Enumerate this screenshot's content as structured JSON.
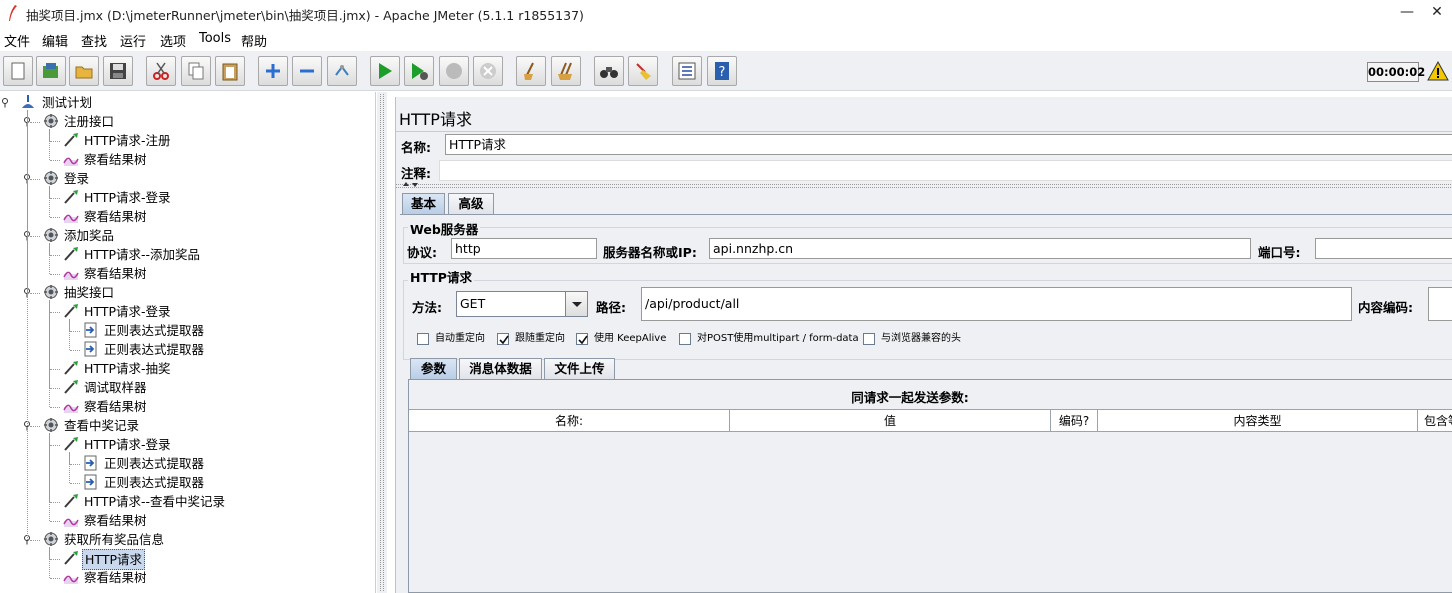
{
  "window": {
    "title": "抽奖项目.jmx (D:\\jmeterRunner\\jmeter\\bin\\抽奖项目.jmx) - Apache JMeter (5.1.1 r1855137)",
    "minimize": "—",
    "close": "✕"
  },
  "menu": [
    "文件",
    "编辑",
    "查找",
    "运行",
    "选项",
    "Tools",
    "帮助"
  ],
  "toolbar": {
    "icons": [
      "new-icon",
      "templates-icon",
      "open-icon",
      "save-icon",
      "cut-icon",
      "copy-icon",
      "paste-icon",
      "expand-icon",
      "collapse-icon",
      "toggle-icon",
      "start-icon",
      "start-no-pause-icon",
      "stop-icon",
      "shutdown-icon",
      "clear-icon",
      "clear-all-icon",
      "search-icon",
      "reset-search-icon",
      "function-helper-icon",
      "help-icon"
    ],
    "timer": "00:00:02",
    "warning_icon": "warning-icon"
  },
  "tree": [
    {
      "label": "测试计划",
      "type": "plan",
      "depth": 0
    },
    {
      "label": "注册接口",
      "type": "thread",
      "depth": 1
    },
    {
      "label": "HTTP请求-注册",
      "type": "sampler",
      "depth": 2
    },
    {
      "label": "察看结果树",
      "type": "listener",
      "depth": 2
    },
    {
      "label": "登录",
      "type": "thread",
      "depth": 1
    },
    {
      "label": "HTTP请求-登录",
      "type": "sampler",
      "depth": 2
    },
    {
      "label": "察看结果树",
      "type": "listener",
      "depth": 2
    },
    {
      "label": "添加奖品",
      "type": "thread",
      "depth": 1
    },
    {
      "label": "HTTP请求--添加奖品",
      "type": "sampler",
      "depth": 2
    },
    {
      "label": "察看结果树",
      "type": "listener",
      "depth": 2
    },
    {
      "label": "抽奖接口",
      "type": "thread",
      "depth": 1
    },
    {
      "label": "HTTP请求-登录",
      "type": "sampler",
      "depth": 2
    },
    {
      "label": "正则表达式提取器",
      "type": "extractor",
      "depth": 3
    },
    {
      "label": "正则表达式提取器",
      "type": "extractor",
      "depth": 3
    },
    {
      "label": "HTTP请求-抽奖",
      "type": "sampler",
      "depth": 2
    },
    {
      "label": "调试取样器",
      "type": "sampler",
      "depth": 2
    },
    {
      "label": "察看结果树",
      "type": "listener",
      "depth": 2
    },
    {
      "label": "查看中奖记录",
      "type": "thread",
      "depth": 1
    },
    {
      "label": "HTTP请求-登录",
      "type": "sampler",
      "depth": 2
    },
    {
      "label": "正则表达式提取器",
      "type": "extractor",
      "depth": 3
    },
    {
      "label": "正则表达式提取器",
      "type": "extractor",
      "depth": 3
    },
    {
      "label": "HTTP请求--查看中奖记录",
      "type": "sampler",
      "depth": 2
    },
    {
      "label": "察看结果树",
      "type": "listener",
      "depth": 2
    },
    {
      "label": "获取所有奖品信息",
      "type": "thread",
      "depth": 1
    },
    {
      "label": "HTTP请求",
      "type": "sampler",
      "depth": 2,
      "selected": true
    },
    {
      "label": "察看结果树",
      "type": "listener",
      "depth": 2
    }
  ],
  "panel": {
    "title": "HTTP请求",
    "name_label": "名称:",
    "name_value": "HTTP请求",
    "comment_label": "注释:",
    "comment_value": "",
    "tabs": [
      "基本",
      "高级"
    ],
    "web_server": {
      "title": "Web服务器",
      "protocol_label": "协议:",
      "protocol_value": "http",
      "server_label": "服务器名称或IP:",
      "server_value": "api.nnzhp.cn",
      "port_label": "端口号:",
      "port_value": ""
    },
    "http_request": {
      "title": "HTTP请求",
      "method_label": "方法:",
      "method_value": "GET",
      "path_label": "路径:",
      "path_value": "/api/product/all",
      "encoding_label": "内容编码:",
      "encoding_value": ""
    },
    "options": [
      {
        "label": "自动重定向",
        "checked": false
      },
      {
        "label": "跟随重定向",
        "checked": true
      },
      {
        "label": "使用 KeepAlive",
        "checked": true
      },
      {
        "label": "对POST使用multipart / form-data",
        "checked": false
      },
      {
        "label": "与浏览器兼容的头",
        "checked": false
      }
    ],
    "param_tabs": [
      "参数",
      "消息体数据",
      "文件上传"
    ],
    "params_title": "同请求一起发送参数:",
    "columns": [
      "名称:",
      "值",
      "编码?",
      "内容类型",
      "包含等于?"
    ]
  }
}
